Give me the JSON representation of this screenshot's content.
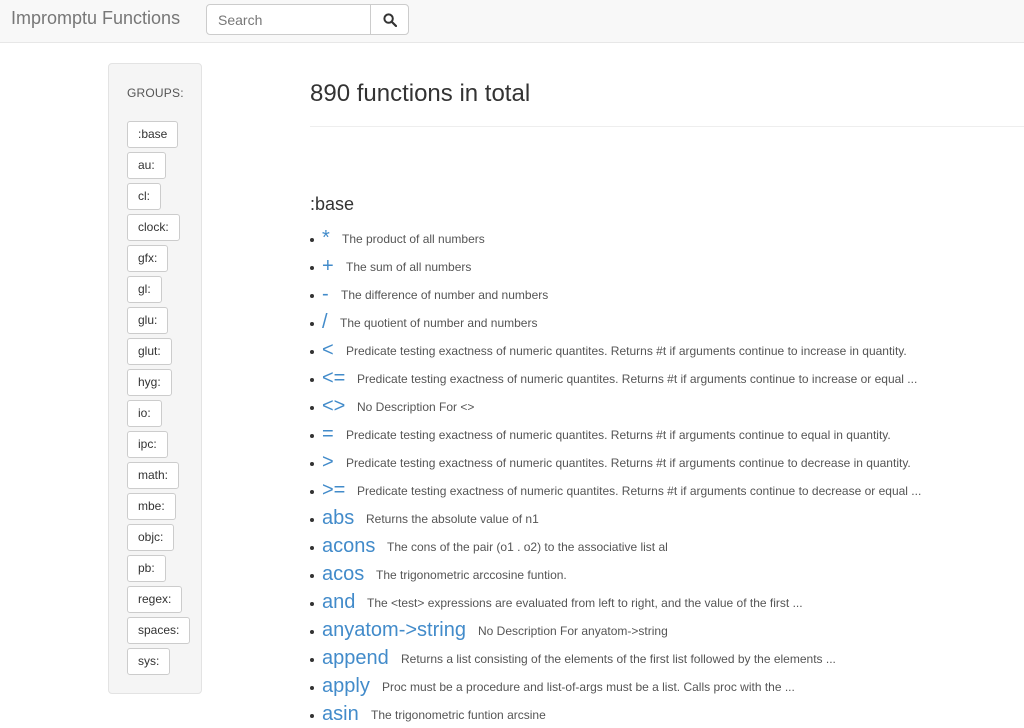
{
  "header": {
    "brand": "Impromptu Functions",
    "search_placeholder": "Search",
    "search_icon": "search-icon"
  },
  "sidebar": {
    "title": "GROUPS:",
    "groups": [
      ":base",
      "au:",
      "cl:",
      "clock:",
      "gfx:",
      "gl:",
      "glu:",
      "glut:",
      "hyg:",
      "io:",
      "ipc:",
      "math:",
      "mbe:",
      "objc:",
      "pb:",
      "regex:",
      "spaces:",
      "sys:"
    ]
  },
  "main": {
    "title": "890 functions in total",
    "section": ":base",
    "functions": [
      {
        "name": "*",
        "desc": "The product of all numbers"
      },
      {
        "name": "+",
        "desc": "The sum of all numbers"
      },
      {
        "name": "-",
        "desc": "The difference of number and numbers"
      },
      {
        "name": "/",
        "desc": "The quotient of number and numbers"
      },
      {
        "name": "<",
        "desc": "Predicate testing exactness of numeric quantites. Returns #t if arguments continue to increase in quantity."
      },
      {
        "name": "<=",
        "desc": "Predicate testing exactness of numeric quantites. Returns #t if arguments continue to increase or equal ..."
      },
      {
        "name": "<>",
        "desc": "No Description For <>"
      },
      {
        "name": "=",
        "desc": "Predicate testing exactness of numeric quantites. Returns #t if arguments continue to equal in quantity."
      },
      {
        "name": ">",
        "desc": "Predicate testing exactness of numeric quantites. Returns #t if arguments continue to decrease in quantity."
      },
      {
        "name": ">=",
        "desc": "Predicate testing exactness of numeric quantites. Returns #t if arguments continue to decrease or equal ..."
      },
      {
        "name": "abs",
        "desc": "Returns the absolute value of n1"
      },
      {
        "name": "acons",
        "desc": "The cons of the pair (o1 . o2) to the associative list al"
      },
      {
        "name": "acos",
        "desc": "The trigonometric arccosine funtion."
      },
      {
        "name": "and",
        "desc": "The <test> expressions are evaluated from left to right, and the value of the first ..."
      },
      {
        "name": "anyatom->string",
        "desc": "No Description For anyatom->string"
      },
      {
        "name": "append",
        "desc": "Returns a list consisting of the elements of the first list followed by the elements ..."
      },
      {
        "name": "apply",
        "desc": "Proc must be a procedure and list-of-args must be a list. Calls proc with the ..."
      },
      {
        "name": "asin",
        "desc": "The trigonometric funtion arcsine"
      }
    ]
  },
  "colors": {
    "link": "#428bca",
    "navbar_bg": "#f8f8f8",
    "sidebar_bg": "#f5f5f5"
  }
}
